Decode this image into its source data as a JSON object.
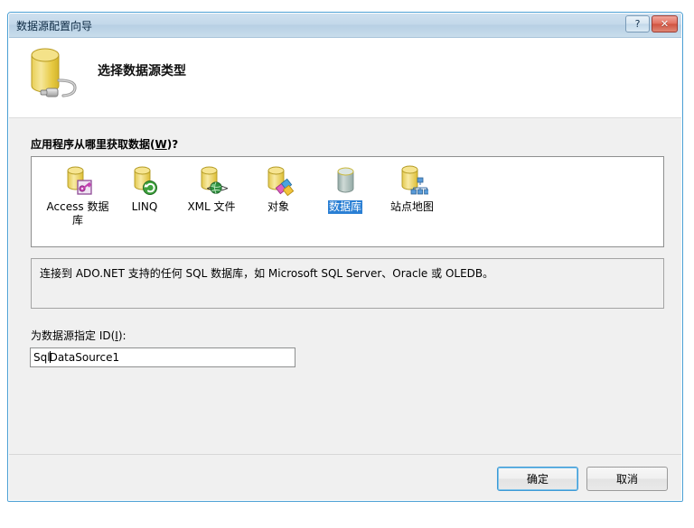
{
  "window": {
    "title": "数据源配置向导",
    "help_button": "?",
    "close_button": "✕"
  },
  "header": {
    "title": "选择数据源类型",
    "icon": "database-plug-icon"
  },
  "main": {
    "prompt_label_prefix": "应用程序从哪里获取数据(",
    "prompt_label_accel": "W",
    "prompt_label_suffix": ")?",
    "sources": [
      {
        "label": "Access 数据库",
        "icon": "access-database-icon",
        "selected": false
      },
      {
        "label": "LINQ",
        "icon": "linq-icon",
        "selected": false
      },
      {
        "label": "XML 文件",
        "icon": "xml-file-icon",
        "selected": false
      },
      {
        "label": "对象",
        "icon": "object-icon",
        "selected": false
      },
      {
        "label": "数据库",
        "icon": "database-icon",
        "selected": true
      },
      {
        "label": "站点地图",
        "icon": "sitemap-icon",
        "selected": false
      }
    ],
    "description": "连接到 ADO.NET 支持的任何 SQL 数据库，如 Microsoft SQL Server、Oracle 或 OLEDB。",
    "id_label_prefix": "为数据源指定 ID(",
    "id_label_accel": "I",
    "id_label_suffix": "):",
    "id_value_before_caret": "Sql",
    "id_value_after_caret": "DataSource1"
  },
  "footer": {
    "ok_label": "确定",
    "cancel_label": "取消"
  },
  "colors": {
    "accent": "#2a7fd4",
    "title_border": "#4a9fd4",
    "default_button_border": "#3c9ad6",
    "panel_border": "#8e8f8f"
  }
}
